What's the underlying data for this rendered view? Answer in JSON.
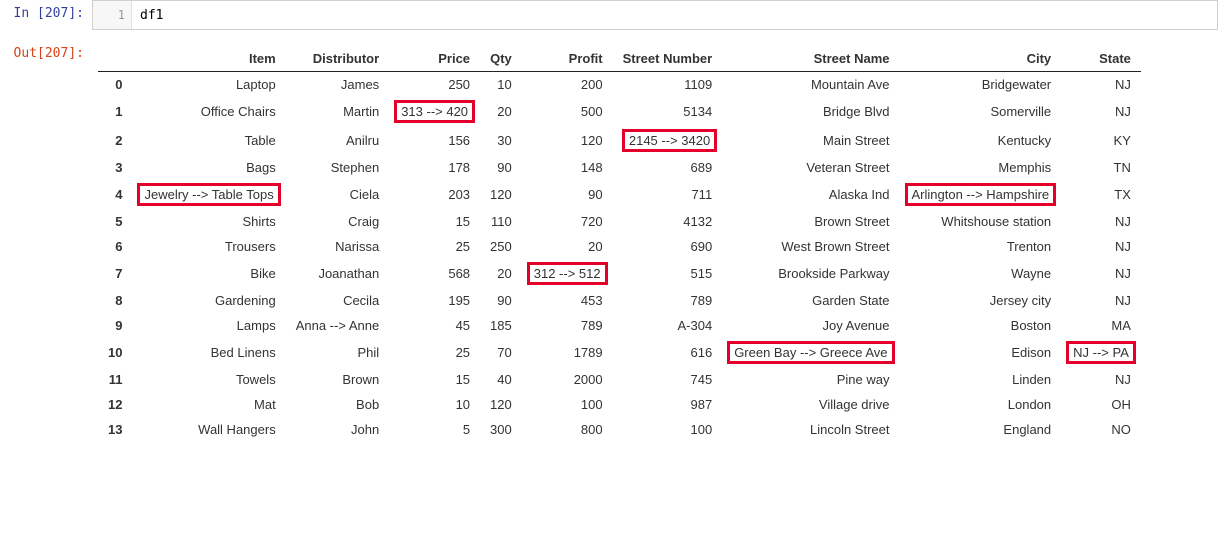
{
  "input_prompt": "In [207]:",
  "input_gutter": "1",
  "input_code": "df1",
  "output_prompt": "Out[207]:",
  "columns": [
    "Item",
    "Distributor",
    "Price",
    "Qty",
    "Profit",
    "Street Number",
    "Street Name",
    "City",
    "State"
  ],
  "rows": [
    {
      "idx": "0",
      "Item": "Laptop",
      "Distributor": "James",
      "Price": "250",
      "Qty": "10",
      "Profit": "200",
      "Street Number": "1109",
      "Street Name": "Mountain Ave",
      "City": "Bridgewater",
      "State": "NJ"
    },
    {
      "idx": "1",
      "Item": "Office Chairs",
      "Distributor": "Martin",
      "Price": "313 --> 420",
      "Qty": "20",
      "Profit": "500",
      "Street Number": "5134",
      "Street Name": "Bridge Blvd",
      "City": "Somerville",
      "State": "NJ"
    },
    {
      "idx": "2",
      "Item": "Table",
      "Distributor": "Anilru",
      "Price": "156",
      "Qty": "30",
      "Profit": "120",
      "Street Number": "2145 --> 3420",
      "Street Name": "Main Street",
      "City": "Kentucky",
      "State": "KY"
    },
    {
      "idx": "3",
      "Item": "Bags",
      "Distributor": "Stephen",
      "Price": "178",
      "Qty": "90",
      "Profit": "148",
      "Street Number": "689",
      "Street Name": "Veteran Street",
      "City": "Memphis",
      "State": "TN"
    },
    {
      "idx": "4",
      "Item": "Jewelry --> Table Tops",
      "Distributor": "Ciela",
      "Price": "203",
      "Qty": "120",
      "Profit": "90",
      "Street Number": "711",
      "Street Name": "Alaska Ind",
      "City": "Arlington --> Hampshire",
      "State": "TX"
    },
    {
      "idx": "5",
      "Item": "Shirts",
      "Distributor": "Craig",
      "Price": "15",
      "Qty": "110",
      "Profit": "720",
      "Street Number": "4132",
      "Street Name": "Brown Street",
      "City": "Whitshouse station",
      "State": "NJ"
    },
    {
      "idx": "6",
      "Item": "Trousers",
      "Distributor": "Narissa",
      "Price": "25",
      "Qty": "250",
      "Profit": "20",
      "Street Number": "690",
      "Street Name": "West Brown Street",
      "City": "Trenton",
      "State": "NJ"
    },
    {
      "idx": "7",
      "Item": "Bike",
      "Distributor": "Joanathan",
      "Price": "568",
      "Qty": "20",
      "Profit": "312 --> 512",
      "Street Number": "515",
      "Street Name": "Brookside Parkway",
      "City": "Wayne",
      "State": "NJ"
    },
    {
      "idx": "8",
      "Item": "Gardening",
      "Distributor": "Cecila",
      "Price": "195",
      "Qty": "90",
      "Profit": "453",
      "Street Number": "789",
      "Street Name": "Garden State",
      "City": "Jersey city",
      "State": "NJ"
    },
    {
      "idx": "9",
      "Item": "Lamps",
      "Distributor": "Anna --> Anne",
      "Price": "45",
      "Qty": "185",
      "Profit": "789",
      "Street Number": "A-304",
      "Street Name": "Joy Avenue",
      "City": "Boston",
      "State": "MA"
    },
    {
      "idx": "10",
      "Item": "Bed Linens",
      "Distributor": "Phil",
      "Price": "25",
      "Qty": "70",
      "Profit": "1789",
      "Street Number": "616",
      "Street Name": "Green Bay --> Greece Ave",
      "City": "Edison",
      "State": "NJ --> PA"
    },
    {
      "idx": "11",
      "Item": "Towels",
      "Distributor": "Brown",
      "Price": "15",
      "Qty": "40",
      "Profit": "2000",
      "Street Number": "745",
      "Street Name": "Pine way",
      "City": "Linden",
      "State": "NJ"
    },
    {
      "idx": "12",
      "Item": "Mat",
      "Distributor": "Bob",
      "Price": "10",
      "Qty": "120",
      "Profit": "100",
      "Street Number": "987",
      "Street Name": "Village drive",
      "City": "London",
      "State": "OH"
    },
    {
      "idx": "13",
      "Item": "Wall Hangers",
      "Distributor": "John",
      "Price": "5",
      "Qty": "300",
      "Profit": "800",
      "Street Number": "100",
      "Street Name": "Lincoln Street",
      "City": "England",
      "State": "NO"
    }
  ],
  "highlights": [
    {
      "row": 1,
      "col": "Price"
    },
    {
      "row": 2,
      "col": "Street Number"
    },
    {
      "row": 4,
      "col": "Item"
    },
    {
      "row": 4,
      "col": "City"
    },
    {
      "row": 7,
      "col": "Profit"
    },
    {
      "row": 10,
      "col": "Street Name"
    },
    {
      "row": 10,
      "col": "State"
    }
  ]
}
